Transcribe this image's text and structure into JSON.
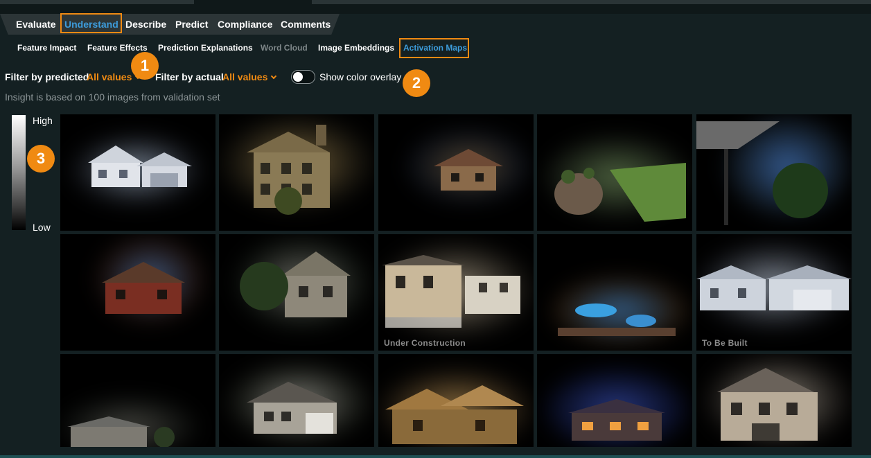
{
  "main_tabs": [
    "Evaluate",
    "Understand",
    "Describe",
    "Predict",
    "Compliance",
    "Comments"
  ],
  "active_main_tab": "Understand",
  "sub_tabs": [
    "Feature Impact",
    "Feature Effects",
    "Prediction Explanations",
    "Word Cloud",
    "Image Embeddings",
    "Activation Maps"
  ],
  "active_sub_tab": "Activation Maps",
  "disabled_sub_tab": "Word Cloud",
  "filters": {
    "predicted_label": "Filter by predicted",
    "predicted_value": "All values",
    "actual_label": "Filter by actual",
    "actual_value": "All values"
  },
  "overlay": {
    "label": "Show color overlay",
    "enabled": false
  },
  "info_text": "Insight is based on 100 images from validation set",
  "legend": {
    "high": "High",
    "low": "Low"
  },
  "callouts": [
    "1",
    "2",
    "3"
  ],
  "captions": {
    "tile_8": "Under Construction",
    "tile_10": "To Be Built"
  },
  "colors": {
    "accent": "#f08a12",
    "active_tab": "#3d9cdb",
    "background": "#142022"
  }
}
